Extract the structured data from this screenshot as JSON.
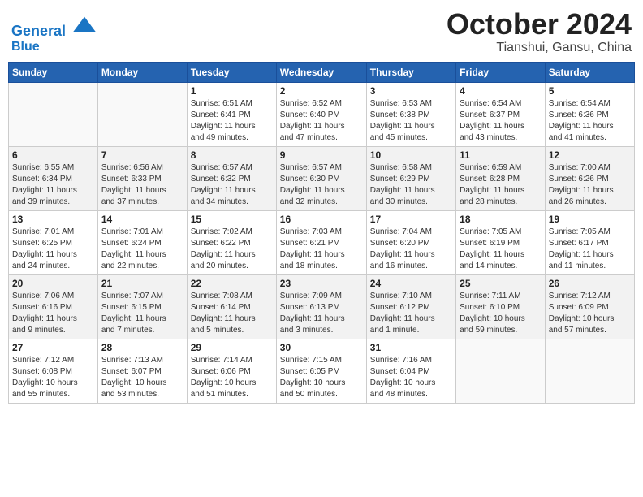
{
  "header": {
    "logo_line1": "General",
    "logo_line2": "Blue",
    "month": "October 2024",
    "location": "Tianshui, Gansu, China"
  },
  "weekdays": [
    "Sunday",
    "Monday",
    "Tuesday",
    "Wednesday",
    "Thursday",
    "Friday",
    "Saturday"
  ],
  "weeks": [
    [
      {
        "day": "",
        "info": ""
      },
      {
        "day": "",
        "info": ""
      },
      {
        "day": "1",
        "info": "Sunrise: 6:51 AM\nSunset: 6:41 PM\nDaylight: 11 hours\nand 49 minutes."
      },
      {
        "day": "2",
        "info": "Sunrise: 6:52 AM\nSunset: 6:40 PM\nDaylight: 11 hours\nand 47 minutes."
      },
      {
        "day": "3",
        "info": "Sunrise: 6:53 AM\nSunset: 6:38 PM\nDaylight: 11 hours\nand 45 minutes."
      },
      {
        "day": "4",
        "info": "Sunrise: 6:54 AM\nSunset: 6:37 PM\nDaylight: 11 hours\nand 43 minutes."
      },
      {
        "day": "5",
        "info": "Sunrise: 6:54 AM\nSunset: 6:36 PM\nDaylight: 11 hours\nand 41 minutes."
      }
    ],
    [
      {
        "day": "6",
        "info": "Sunrise: 6:55 AM\nSunset: 6:34 PM\nDaylight: 11 hours\nand 39 minutes."
      },
      {
        "day": "7",
        "info": "Sunrise: 6:56 AM\nSunset: 6:33 PM\nDaylight: 11 hours\nand 37 minutes."
      },
      {
        "day": "8",
        "info": "Sunrise: 6:57 AM\nSunset: 6:32 PM\nDaylight: 11 hours\nand 34 minutes."
      },
      {
        "day": "9",
        "info": "Sunrise: 6:57 AM\nSunset: 6:30 PM\nDaylight: 11 hours\nand 32 minutes."
      },
      {
        "day": "10",
        "info": "Sunrise: 6:58 AM\nSunset: 6:29 PM\nDaylight: 11 hours\nand 30 minutes."
      },
      {
        "day": "11",
        "info": "Sunrise: 6:59 AM\nSunset: 6:28 PM\nDaylight: 11 hours\nand 28 minutes."
      },
      {
        "day": "12",
        "info": "Sunrise: 7:00 AM\nSunset: 6:26 PM\nDaylight: 11 hours\nand 26 minutes."
      }
    ],
    [
      {
        "day": "13",
        "info": "Sunrise: 7:01 AM\nSunset: 6:25 PM\nDaylight: 11 hours\nand 24 minutes."
      },
      {
        "day": "14",
        "info": "Sunrise: 7:01 AM\nSunset: 6:24 PM\nDaylight: 11 hours\nand 22 minutes."
      },
      {
        "day": "15",
        "info": "Sunrise: 7:02 AM\nSunset: 6:22 PM\nDaylight: 11 hours\nand 20 minutes."
      },
      {
        "day": "16",
        "info": "Sunrise: 7:03 AM\nSunset: 6:21 PM\nDaylight: 11 hours\nand 18 minutes."
      },
      {
        "day": "17",
        "info": "Sunrise: 7:04 AM\nSunset: 6:20 PM\nDaylight: 11 hours\nand 16 minutes."
      },
      {
        "day": "18",
        "info": "Sunrise: 7:05 AM\nSunset: 6:19 PM\nDaylight: 11 hours\nand 14 minutes."
      },
      {
        "day": "19",
        "info": "Sunrise: 7:05 AM\nSunset: 6:17 PM\nDaylight: 11 hours\nand 11 minutes."
      }
    ],
    [
      {
        "day": "20",
        "info": "Sunrise: 7:06 AM\nSunset: 6:16 PM\nDaylight: 11 hours\nand 9 minutes."
      },
      {
        "day": "21",
        "info": "Sunrise: 7:07 AM\nSunset: 6:15 PM\nDaylight: 11 hours\nand 7 minutes."
      },
      {
        "day": "22",
        "info": "Sunrise: 7:08 AM\nSunset: 6:14 PM\nDaylight: 11 hours\nand 5 minutes."
      },
      {
        "day": "23",
        "info": "Sunrise: 7:09 AM\nSunset: 6:13 PM\nDaylight: 11 hours\nand 3 minutes."
      },
      {
        "day": "24",
        "info": "Sunrise: 7:10 AM\nSunset: 6:12 PM\nDaylight: 11 hours\nand 1 minute."
      },
      {
        "day": "25",
        "info": "Sunrise: 7:11 AM\nSunset: 6:10 PM\nDaylight: 10 hours\nand 59 minutes."
      },
      {
        "day": "26",
        "info": "Sunrise: 7:12 AM\nSunset: 6:09 PM\nDaylight: 10 hours\nand 57 minutes."
      }
    ],
    [
      {
        "day": "27",
        "info": "Sunrise: 7:12 AM\nSunset: 6:08 PM\nDaylight: 10 hours\nand 55 minutes."
      },
      {
        "day": "28",
        "info": "Sunrise: 7:13 AM\nSunset: 6:07 PM\nDaylight: 10 hours\nand 53 minutes."
      },
      {
        "day": "29",
        "info": "Sunrise: 7:14 AM\nSunset: 6:06 PM\nDaylight: 10 hours\nand 51 minutes."
      },
      {
        "day": "30",
        "info": "Sunrise: 7:15 AM\nSunset: 6:05 PM\nDaylight: 10 hours\nand 50 minutes."
      },
      {
        "day": "31",
        "info": "Sunrise: 7:16 AM\nSunset: 6:04 PM\nDaylight: 10 hours\nand 48 minutes."
      },
      {
        "day": "",
        "info": ""
      },
      {
        "day": "",
        "info": ""
      }
    ]
  ]
}
